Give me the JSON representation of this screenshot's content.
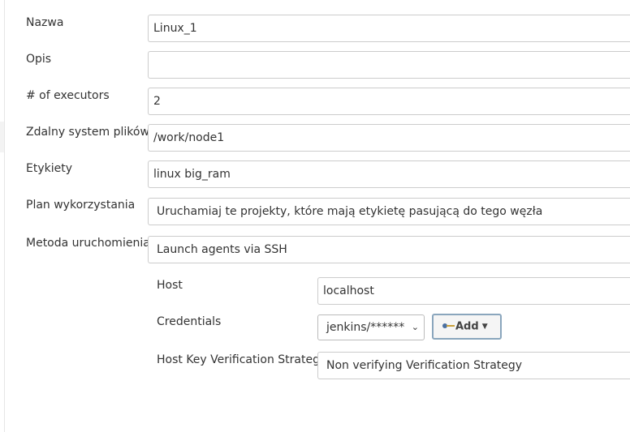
{
  "form": {
    "name": {
      "label": "Nazwa",
      "value": "Linux_1"
    },
    "description": {
      "label": "Opis",
      "value": ""
    },
    "executors": {
      "label": "# of executors",
      "value": "2"
    },
    "remote_fs": {
      "label": "Zdalny system plików",
      "value": "/work/node1"
    },
    "labels": {
      "label": "Etykiety",
      "value": "linux big_ram"
    },
    "usage": {
      "label": "Plan wykorzystania",
      "value": "Uruchamiaj te projekty, które mają etykietę pasującą do tego węzła"
    },
    "launch_method": {
      "label": "Metoda uruchomienia",
      "value": "Launch agents via SSH"
    }
  },
  "ssh": {
    "host": {
      "label": "Host",
      "value": "localhost"
    },
    "credentials": {
      "label": "Credentials",
      "value": "jenkins/******",
      "add_label": "Add"
    },
    "host_key": {
      "label": "Host Key Verification Strategy",
      "value": "Non verifying Verification Strategy"
    }
  },
  "icons": {
    "key": "key-icon",
    "dropdown": "chevron-down-icon",
    "caret": "caret-down-icon"
  }
}
